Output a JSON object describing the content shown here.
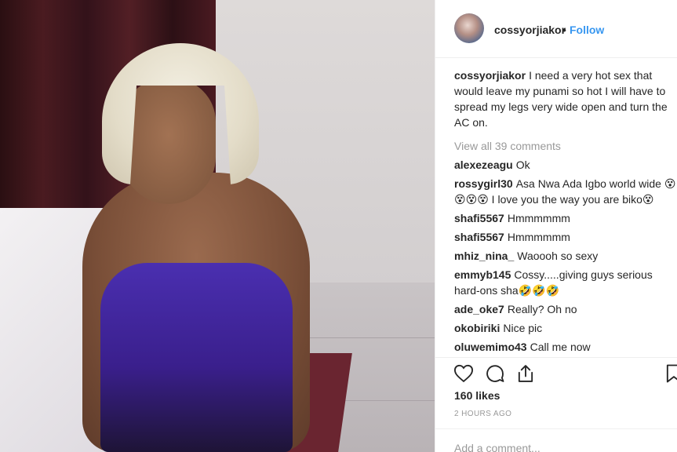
{
  "post": {
    "image_alt": "post-photo",
    "header": {
      "username": "cossyorjiakor",
      "separator": "•",
      "follow_label": "Follow"
    },
    "caption": {
      "username": "cossyorjiakor",
      "text": "I need a very hot sex that would leave my punami so hot I will have to spread my legs very wide open and turn the AC on."
    },
    "view_all_label": "View all 39 comments",
    "comments": [
      {
        "username": "alexezeagu",
        "text": "Ok"
      },
      {
        "username": "rossygirl30",
        "text": "Asa Nwa Ada Igbo world wide 😵😵😵😵 I love you the way you are biko😵"
      },
      {
        "username": "shafi5567",
        "text": "Hmmmmmm"
      },
      {
        "username": "shafi5567",
        "text": "Hmmmmmm"
      },
      {
        "username": "mhiz_nina_",
        "text": "Waoooh so sexy"
      },
      {
        "username": "emmyb145",
        "text": "Cossy.....giving guys serious hard-ons sha🤣🤣🤣"
      },
      {
        "username": "ade_oke7",
        "text": "Really? Oh no"
      },
      {
        "username": "okobiriki",
        "text": "Nice pic"
      },
      {
        "username": "oluwemimo43",
        "text": "Call me now"
      }
    ],
    "actions": {
      "like_icon": "heart-icon",
      "comment_icon": "comment-icon",
      "share_icon": "share-icon",
      "save_icon": "bookmark-icon"
    },
    "likes_label": "160 likes",
    "timestamp": "2 HOURS AGO",
    "add_comment_placeholder": "Add a comment...",
    "colors": {
      "link": "#3897f0",
      "text": "#262626",
      "muted": "#999999",
      "divider": "#efefef"
    }
  }
}
